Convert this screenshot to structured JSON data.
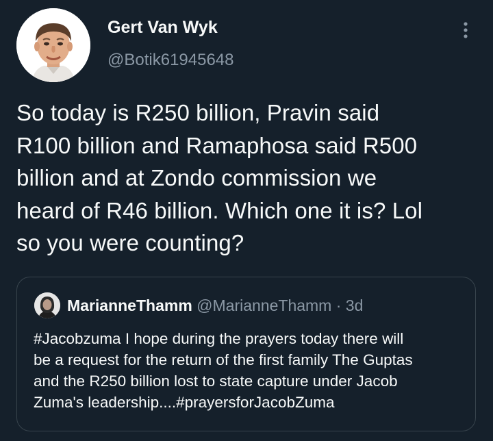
{
  "author": {
    "name": "Gert Van Wyk",
    "handle": "@Botik61945648"
  },
  "more_icon": "more-vertical-icon",
  "tweet": {
    "text_lines": [
      "So today is R250 billion, Pravin said",
      "R100 billion and Ramaphosa said R500",
      "billion and at Zondo commission we",
      "heard of R46 billion. Which one it is? Lol",
      "so you were counting?"
    ]
  },
  "quoted_tweet": {
    "name": "MarianneThamm",
    "handle": "@MarianneThamm",
    "separator": "·",
    "time": "3d",
    "text_lines": [
      "#Jacobzuma I hope during the prayers today there will",
      "be a request for the return of the first family The Guptas",
      "and the R250 billion lost to state capture under Jacob",
      "Zuma's leadership....#prayersforJacobZuma"
    ]
  },
  "colors": {
    "background": "#15202b",
    "text_primary": "#f7f9f9",
    "text_secondary": "#8b98a5",
    "border": "#38444d"
  }
}
